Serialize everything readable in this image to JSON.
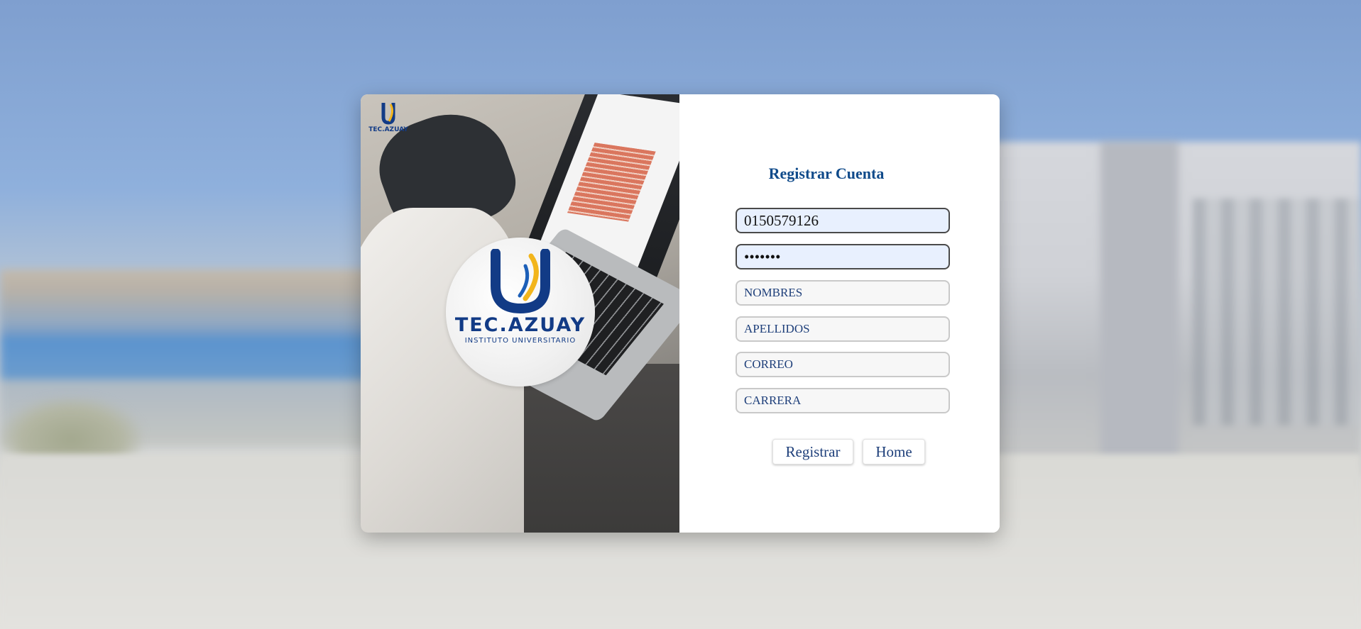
{
  "logo": {
    "brand": "TEC.AZUAY",
    "subtitle": "INSTITUTO UNIVERSITARIO"
  },
  "form": {
    "title": "Registrar Cuenta",
    "cedula_value": "0150579126",
    "password_value": "•••••••",
    "nombres_placeholder": "NOMBRES",
    "apellidos_placeholder": "APELLIDOS",
    "correo_placeholder": "CORREO",
    "carrera_placeholder": "CARRERA"
  },
  "buttons": {
    "register_label": "Registrar",
    "home_label": "Home"
  },
  "colors": {
    "title": "#0f4a8a",
    "logo_blue": "#123b86",
    "logo_yellow": "#f2b51c",
    "autofill": "#e8f0fe"
  }
}
